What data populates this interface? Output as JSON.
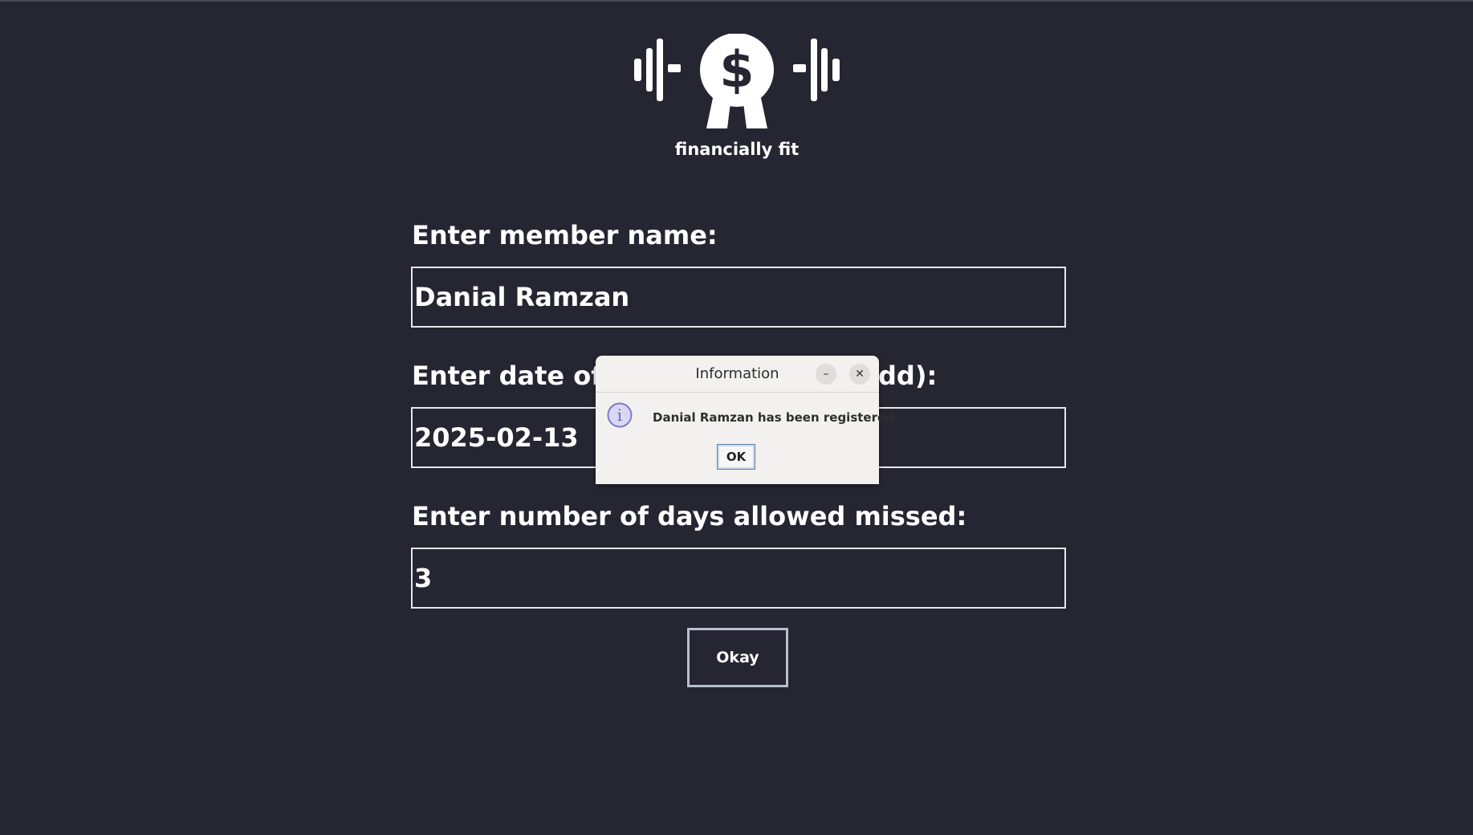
{
  "app": {
    "logo_text": "financially fit",
    "logo_symbol": "$"
  },
  "form": {
    "name_label": "Enter member name:",
    "name_value": "Danial Ramzan",
    "date_label_left": "Enter date of r",
    "date_label_right": "dd):",
    "date_value": "2025-02-13",
    "days_label": "Enter number of days allowed missed:",
    "days_value": "3",
    "submit_label": "Okay"
  },
  "dialog": {
    "title": "Information",
    "minimize_glyph": "–",
    "close_glyph": "✕",
    "info_glyph": "i",
    "message": "Danial Ramzan has been registered.",
    "ok_label": "OK"
  },
  "colors": {
    "background": "#262633",
    "dialog_background": "#f2f1ef",
    "info_icon": "#7e7acc"
  }
}
